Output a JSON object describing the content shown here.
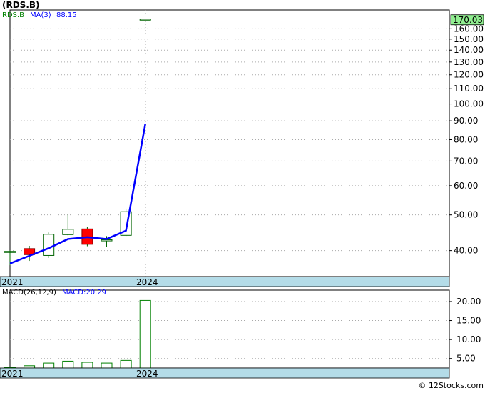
{
  "title": "(RDS.B)",
  "watermark": "© 12Stocks.com",
  "colors": {
    "bull_border": "#006400",
    "bear_fill": "#ff0000",
    "ma_line": "#0000ff",
    "axis_band": "#b4dce8",
    "price_tag": "#90ee90",
    "grid": "#aaaaaa",
    "macd_bar": "#008000"
  },
  "chart_data": [
    {
      "type": "candlestick",
      "legend": {
        "symbol": "RDS.B",
        "ma_label": "MA(3)",
        "ma_value": "88.15"
      },
      "last_price_label": "170.03",
      "scale": "log",
      "ylim": [
        34,
        180
      ],
      "x_tick_labels": [
        "2021",
        "2024"
      ],
      "y_tick_labels": [
        "40.00",
        "50.00",
        "60.00",
        "70.00",
        "80.00",
        "90.00",
        "100.00",
        "110.00",
        "120.00",
        "130.00",
        "140.00",
        "150.00",
        "160.00"
      ],
      "y_ticks": [
        40,
        50,
        60,
        70,
        80,
        90,
        100,
        110,
        120,
        130,
        140,
        150,
        160
      ],
      "candles": [
        {
          "period": 1,
          "open": 39.8,
          "high": 40.0,
          "low": 36.5,
          "close": 39.8
        },
        {
          "period": 2,
          "open": 40.5,
          "high": 41.2,
          "low": 37.5,
          "close": 39.0
        },
        {
          "period": 3,
          "open": 38.8,
          "high": 44.8,
          "low": 38.2,
          "close": 44.3
        },
        {
          "period": 4,
          "open": 44.2,
          "high": 50.0,
          "low": 44.0,
          "close": 45.7
        },
        {
          "period": 5,
          "open": 45.8,
          "high": 46.3,
          "low": 41.1,
          "close": 41.6
        },
        {
          "period": 6,
          "open": 42.5,
          "high": 43.8,
          "low": 41.0,
          "close": 42.8
        },
        {
          "period": 7,
          "open": 44.0,
          "high": 52.0,
          "low": 43.8,
          "close": 51.0
        },
        {
          "period": 8,
          "open": 170.0,
          "high": 170.5,
          "low": 169.8,
          "close": 170.03
        }
      ],
      "ma": {
        "periods": [
          1,
          2,
          3,
          4,
          5,
          6,
          7,
          8
        ],
        "values": [
          36.9,
          38.7,
          40.6,
          43.0,
          43.5,
          43.0,
          45.3,
          88.15
        ]
      }
    },
    {
      "type": "bar",
      "legend": {
        "label": "MACD(26,12,9)",
        "value_label": "MACD:20.29"
      },
      "ylim": [
        2.5,
        23
      ],
      "y_tick_labels": [
        "5.00",
        "10.00",
        "15.00",
        "20.00"
      ],
      "y_ticks": [
        5,
        10,
        15,
        20
      ],
      "x_tick_labels": [
        "2021",
        "2024"
      ],
      "bars": [
        {
          "period": 1,
          "value": 2.6
        },
        {
          "period": 2,
          "value": 3.1
        },
        {
          "period": 3,
          "value": 3.8
        },
        {
          "period": 4,
          "value": 4.3
        },
        {
          "period": 5,
          "value": 4.0
        },
        {
          "period": 6,
          "value": 3.8
        },
        {
          "period": 7,
          "value": 4.5
        },
        {
          "period": 8,
          "value": 20.29
        }
      ]
    }
  ]
}
